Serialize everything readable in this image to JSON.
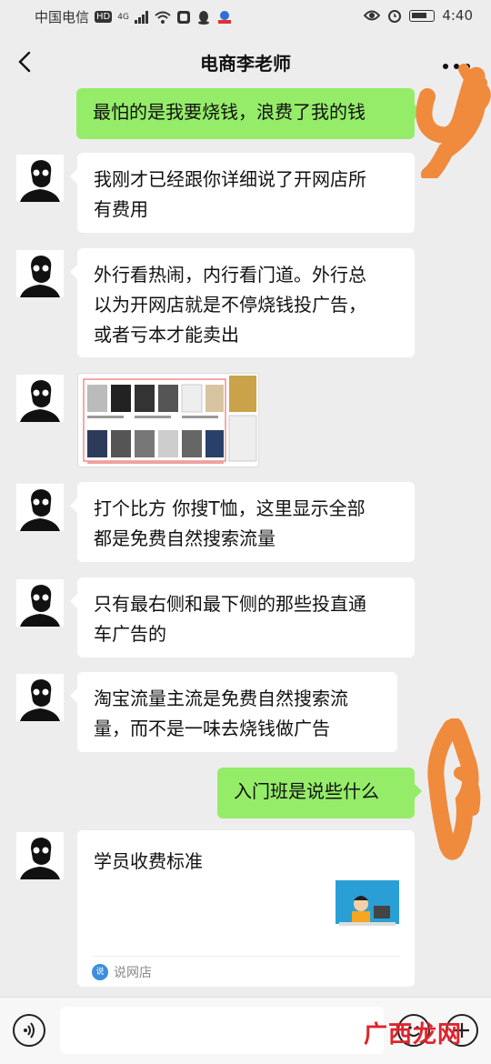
{
  "status_bar": {
    "carrier": "中国电信",
    "network_badge": "HD",
    "network_type": "4G",
    "time": "4:40"
  },
  "nav": {
    "title": "电商李老师",
    "back_icon": "chevron-left-icon",
    "more_icon": "more-horizontal-icon"
  },
  "messages": [
    {
      "side": "right",
      "text": "最怕的是我要烧钱，浪费了我的钱"
    },
    {
      "side": "left",
      "text_lines": [
        "我刚才已经跟你详细说了开网店所",
        "有费用"
      ]
    },
    {
      "side": "left",
      "text_lines": [
        "外行看热闹，内行看门道。外行总",
        "以为开网店就是不停烧钱投广告，",
        "或者亏本才能卖出"
      ]
    },
    {
      "side": "left",
      "type": "image"
    },
    {
      "side": "left",
      "text_lines": [
        "打个比方 你搜T恤，这里显示全部",
        "都是免费自然搜索流量"
      ]
    },
    {
      "side": "left",
      "text_lines": [
        "只有最右侧和最下侧的那些投直通",
        "车广告的"
      ]
    },
    {
      "side": "left",
      "text_lines": [
        "淘宝流量主流是免费自然搜索流",
        "量，而不是一味去烧钱做广告"
      ]
    },
    {
      "side": "right",
      "text": "入门班是说些什么"
    }
  ],
  "card": {
    "title": "学员收费标准",
    "source": "说网店",
    "source_logo": "说"
  },
  "input_bar": {
    "voice_icon": "voice-icon",
    "emoji_icon": "emoji-icon",
    "plus_icon": "plus-icon",
    "placeholder": ""
  },
  "watermark": "广西龙网",
  "colors": {
    "background": "#ededed",
    "own_bubble": "#95ec69",
    "other_bubble": "#ffffff",
    "doodle": "#f08a3c"
  }
}
